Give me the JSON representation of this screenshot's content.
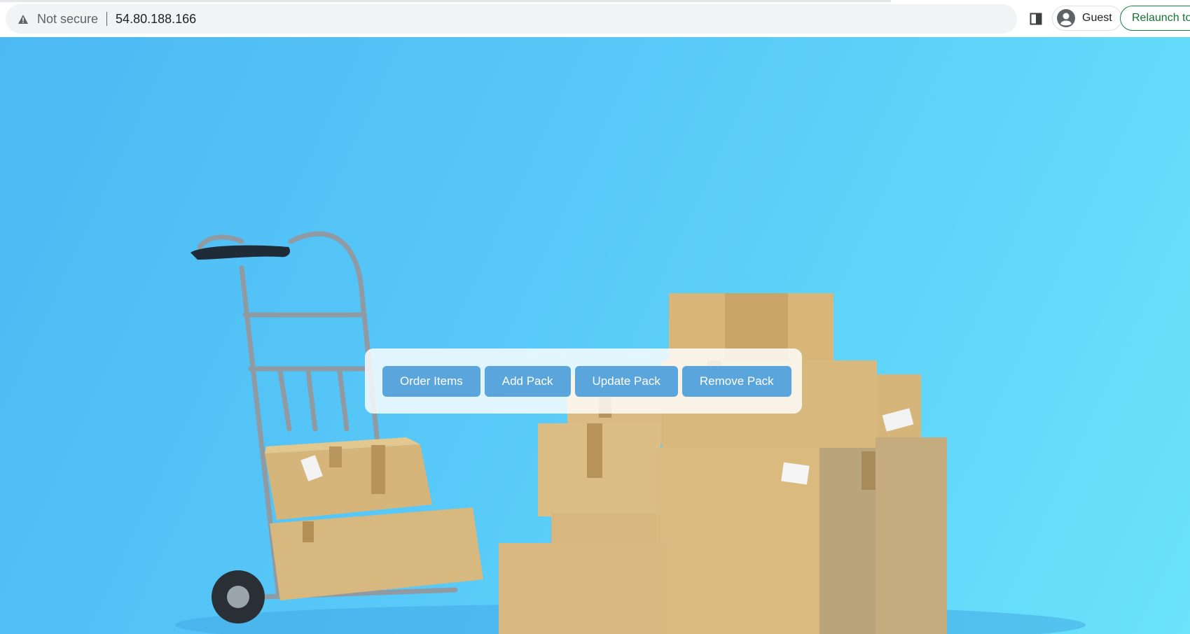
{
  "browser": {
    "security_label": "Not secure",
    "url": "54.80.188.166",
    "profile_name": "Guest",
    "relaunch_label": "Relaunch to",
    "relaunch_color": "#188038"
  },
  "hero": {
    "description_icons": [
      "hand-truck-icon",
      "cardboard-box-icon"
    ]
  },
  "menu": {
    "buttons": [
      {
        "label": "Order Items"
      },
      {
        "label": "Add Pack"
      },
      {
        "label": "Update Pack"
      },
      {
        "label": "Remove Pack"
      }
    ],
    "button_color": "#5aa5db"
  }
}
